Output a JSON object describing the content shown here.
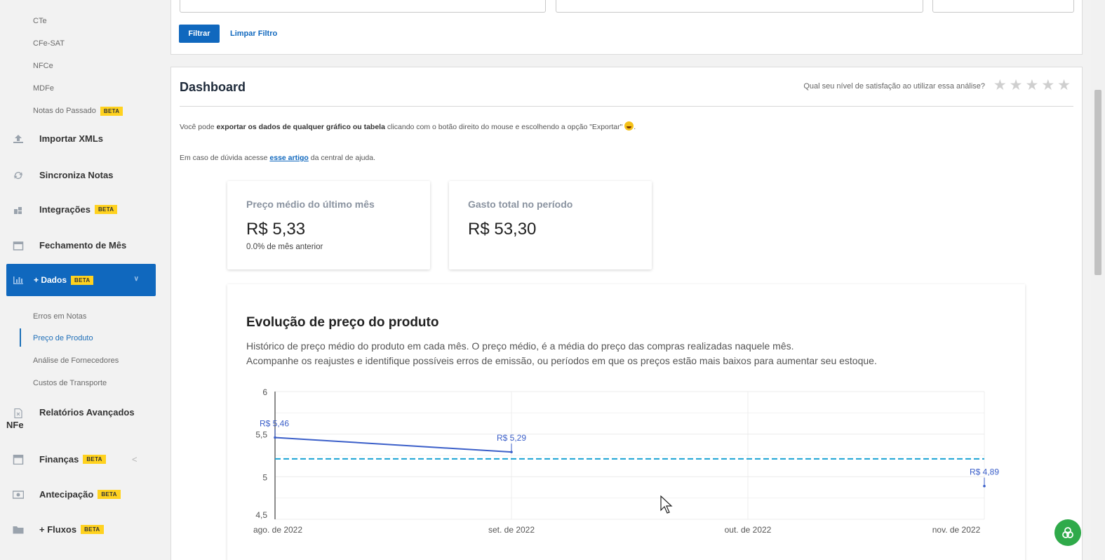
{
  "sidebar": {
    "sub_top": [
      "CTe",
      "CFe-SAT",
      "NFCe",
      "MDFe",
      "Notas do Passado"
    ],
    "notas_passado_badge": "BETA",
    "menu": [
      {
        "label": "Importar XMLs",
        "badge": ""
      },
      {
        "label": "Sincroniza Notas",
        "badge": ""
      },
      {
        "label": "Integrações",
        "badge": "BETA"
      },
      {
        "label": "Fechamento de Mês",
        "badge": ""
      }
    ],
    "dados": {
      "label": "+ Dados",
      "badge": "BETA"
    },
    "dados_sub": [
      "Erros em Notas",
      "Preço de Produto",
      "Análise de Fornecedores",
      "Custos de Transporte"
    ],
    "menu_bottom": [
      {
        "label": "Relatórios Avançados",
        "label2": "NFe",
        "badge": ""
      },
      {
        "label": "Finanças",
        "badge": "BETA"
      },
      {
        "label": "Antecipação",
        "badge": "BETA"
      },
      {
        "label": "+ Fluxos",
        "badge": "BETA"
      }
    ]
  },
  "filter": {
    "filtrar": "Filtrar",
    "limpar": "Limpar Filtro"
  },
  "dashboard": {
    "title": "Dashboard",
    "rating_question": "Qual seu nível de satisfação ao utilizar essa análise?",
    "stars": "★★★★★",
    "info1_pre": "Você pode ",
    "info1_bold": "exportar os dados de qualquer gráfico ou tabela",
    "info1_post": " clicando com o botão direito do mouse e escolhendo a opção \"Exportar\" ",
    "info1_end": ".",
    "info2_pre": "Em caso de dúvida acesse ",
    "info2_link": "esse artigo",
    "info2_post": " da central de ajuda."
  },
  "kpis": [
    {
      "label": "Preço médio do último mês",
      "value": "R$ 5,33",
      "sub": "0.0% de mês anterior"
    },
    {
      "label": "Gasto total no período",
      "value": "R$ 53,30",
      "sub": ""
    }
  ],
  "chart": {
    "title": "Evolução de preço do produto",
    "desc1": "Histórico de preço médio do produto em cada mês. O preço médio, é a média do preço das compras realizadas naquele mês.",
    "desc2": "Acompanhe os reajustes e identifique possíveis erros de emissão, ou períodos em que os preços estão mais baixos para aumentar seu estoque."
  },
  "chart_data": {
    "type": "line",
    "categories": [
      "ago. de 2022",
      "set. de 2022",
      "out. de 2022",
      "nov. de 2022"
    ],
    "series": [
      {
        "values": [
          5.46,
          5.29,
          null,
          4.89
        ],
        "labels": [
          "R$ 5,46",
          "R$ 5,29",
          "",
          "R$ 4,89"
        ]
      }
    ],
    "average_line": 5.21,
    "ylim": [
      4.5,
      6
    ],
    "yticks": [
      "6",
      "5,5",
      "5",
      "4,5"
    ],
    "colors": {
      "series": "#3b5fc9",
      "average": "#1aa3d4"
    },
    "grid": true
  },
  "fab_icon": "link-icon"
}
